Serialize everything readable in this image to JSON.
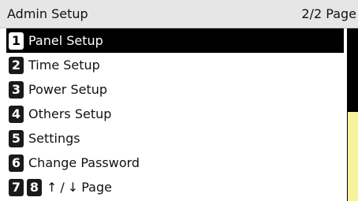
{
  "header": {
    "title": "Admin Setup",
    "page_indicator": "2/2 Page"
  },
  "menu": {
    "items": [
      {
        "number": "1",
        "label": "Panel Setup",
        "selected": true
      },
      {
        "number": "2",
        "label": "Time Setup",
        "selected": false
      },
      {
        "number": "3",
        "label": "Power Setup",
        "selected": false
      },
      {
        "number": "4",
        "label": "Others Setup",
        "selected": false
      },
      {
        "number": "5",
        "label": "Settings",
        "selected": false
      },
      {
        "number": "6",
        "label": "Change Password",
        "selected": false
      }
    ],
    "paging": {
      "prev_number": "7",
      "next_number": "8",
      "up_arrow": "↑",
      "separator": "/",
      "down_arrow": "↓",
      "label": "Page"
    }
  },
  "scroll": {
    "position": 0.5
  },
  "colors": {
    "header_bg": "#e6e6e6",
    "selected_bg": "#000000",
    "scrollbar_track": "#000000",
    "scrollbar_thumb": "#f7f29e"
  }
}
